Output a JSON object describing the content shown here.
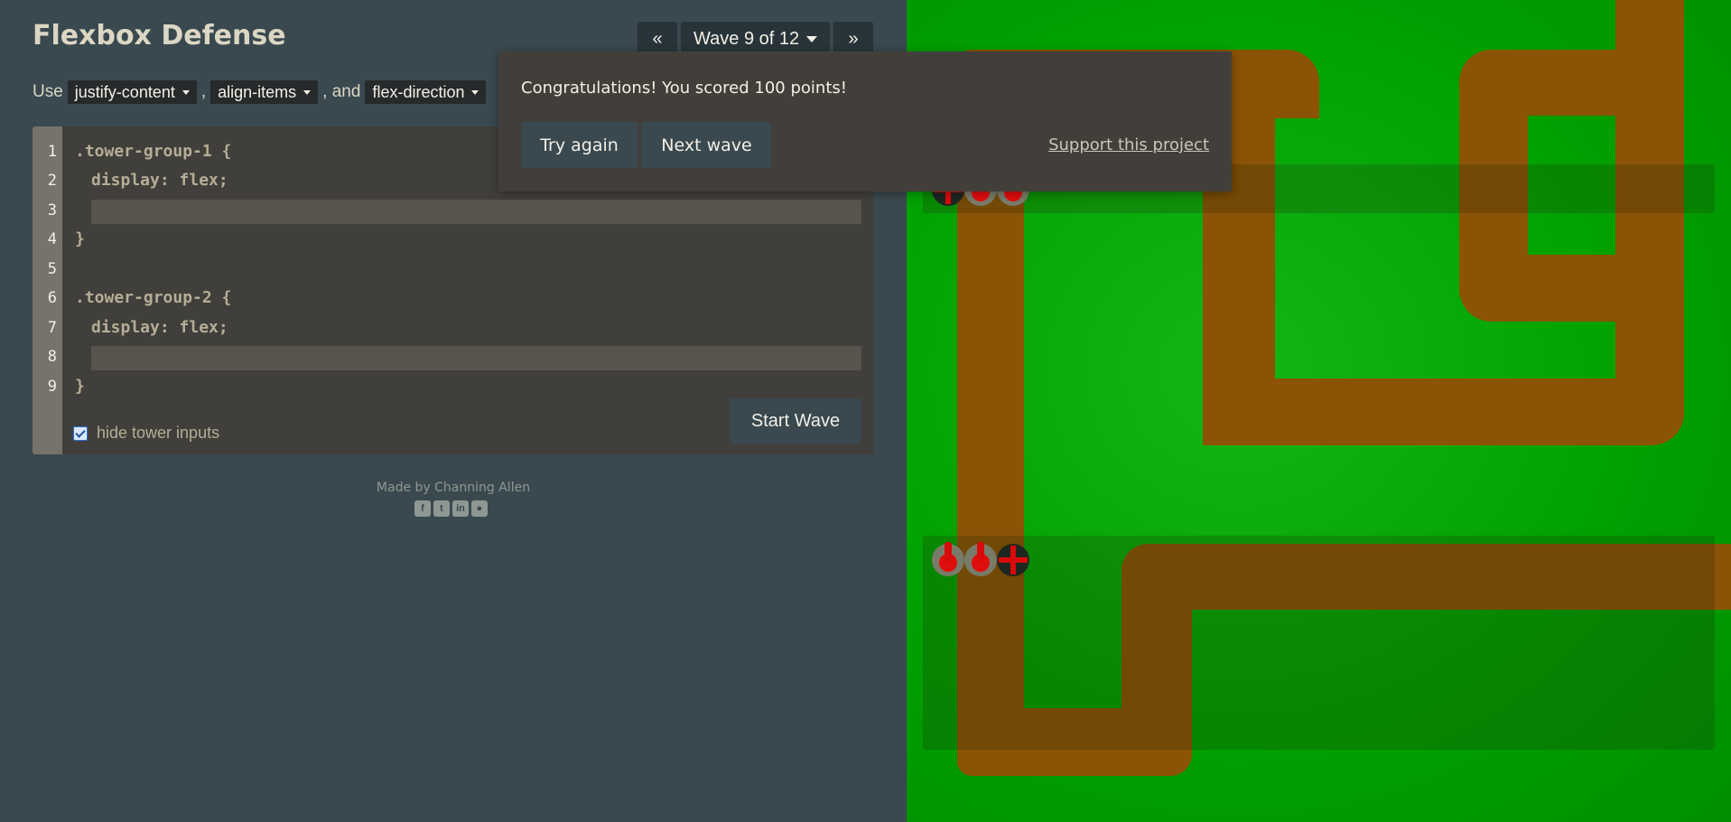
{
  "header": {
    "title": "Flexbox Defense"
  },
  "wave_nav": {
    "prev_label": "«",
    "current_label": "Wave 9 of 12",
    "next_label": "»"
  },
  "instructions": {
    "prefix": "Use",
    "prop1": "justify-content",
    "sep1": ",",
    "prop2": "align-items",
    "sep2": ", and",
    "prop3": "flex-direction"
  },
  "editor": {
    "line_numbers": [
      "1",
      "2",
      "3",
      "4",
      "5",
      "6",
      "7",
      "8",
      "9"
    ],
    "lines": {
      "l1": ".tower-group-1 {",
      "l2": "display: flex;",
      "l4": "}",
      "l6": ".tower-group-2 {",
      "l7": "display: flex;",
      "l9": "}"
    },
    "hide_tower_inputs_label": "hide tower inputs",
    "hide_tower_inputs_checked": true,
    "start_wave_label": "Start Wave"
  },
  "footer": {
    "credit": "Made by Channing Allen",
    "social_icons": [
      "facebook-icon",
      "twitter-icon",
      "linkedin-icon",
      "github-icon"
    ]
  },
  "modal": {
    "message": "Congratulations! You scored 100 points!",
    "try_again_label": "Try again",
    "next_wave_label": "Next wave",
    "support_label": "Support this project"
  },
  "board": {
    "colors": {
      "grass": "#01a101",
      "road": "#8b5306",
      "tower_gun": "#d80a0a",
      "tower_base": "#797b6a"
    }
  }
}
